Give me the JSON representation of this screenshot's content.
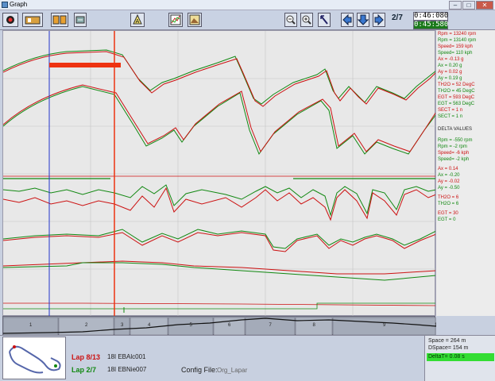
{
  "window": {
    "title": "Graph"
  },
  "toolbar": {
    "lap_counter": "2/7",
    "time_total": "0:46:080",
    "time_current": "0:45:580"
  },
  "panel": {
    "lines": [
      {
        "t": "Rpm =  13240 rpm",
        "c": "r"
      },
      {
        "t": "Rpm =  13140 rpm",
        "c": "g"
      },
      {
        "t": "Speed=    159 kph",
        "c": "r"
      },
      {
        "t": "Speed=    110 kph",
        "c": "g"
      },
      {
        "t": "Ax  =  -0.13  g",
        "c": "r"
      },
      {
        "t": "Ax  =   0.20  g",
        "c": "g"
      },
      {
        "t": "Ay  =   0.02  g",
        "c": "r"
      },
      {
        "t": "Ay  =   0.19  g",
        "c": "g"
      },
      {
        "t": "TH2O =   52 DegC",
        "c": "r"
      },
      {
        "t": "TH2O =   45 DegC",
        "c": "g"
      },
      {
        "t": "EGT  =  593 DegC",
        "c": "r"
      },
      {
        "t": "EGT  =  563 DegC",
        "c": "g"
      },
      {
        "t": "SECT =    1  n",
        "c": "r"
      },
      {
        "t": "SECT =    1  n",
        "c": "g"
      },
      {
        "t": "DELTA VALUES",
        "c": "k"
      },
      {
        "t": "Rpm =   -550 rpm",
        "c": "g"
      },
      {
        "t": "Rpm =     -2 rpm",
        "c": "g"
      },
      {
        "t": "Speed=     -6 kph",
        "c": "r"
      },
      {
        "t": "Speed=     -2 kph",
        "c": "g"
      },
      {
        "t": "Ax  =   0.14",
        "c": "r"
      },
      {
        "t": "Ax  =  -0.20",
        "c": "g"
      },
      {
        "t": "Ay  =  -0.02",
        "c": "r"
      },
      {
        "t": "Ay  =  -0.50",
        "c": "g"
      },
      {
        "t": "TH2O =     6",
        "c": "r"
      },
      {
        "t": "TH2O =     6",
        "c": "g"
      },
      {
        "t": "EGT  =    30",
        "c": "r"
      },
      {
        "t": "EGT  =     0",
        "c": "g"
      }
    ]
  },
  "trackbar": {
    "sectors": [
      "1",
      "2",
      "3",
      "4",
      "5",
      "6",
      "7",
      "8",
      "9",
      "10"
    ]
  },
  "bottom": {
    "lap_a": "Lap 8/13",
    "lap_b": "Lap 2/7",
    "file_a": "18I EBAlc001",
    "file_b": "18I EBNie007",
    "config_label": "Config File:",
    "config_value": "Org_Lapar"
  },
  "distance": {
    "space": "Space =   264  m",
    "dspace": "DSpace=   154  m",
    "delta": "DeltaT=   0.08  s"
  },
  "colors": {
    "lap_a": "#cc1111",
    "lap_b": "#118811",
    "cursor_a": "#2233cc",
    "cursor_b": "#ee3311"
  }
}
